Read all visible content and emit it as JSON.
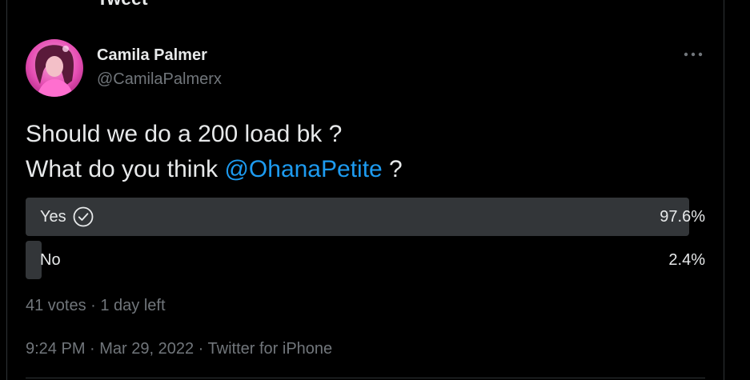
{
  "header": {
    "title": "Tweet"
  },
  "author": {
    "display_name": "Camila Palmer",
    "handle": "@CamilaPalmerx",
    "avatar_icon": "profile-photo"
  },
  "tweet": {
    "line1": "Should we do a 200 load bk ?",
    "line2_prefix": "What do you think ",
    "mention": "@OhanaPetite",
    "line2_suffix": " ?"
  },
  "poll": {
    "options": [
      {
        "label": "Yes",
        "percent_text": "97.6%",
        "share": 0.976,
        "winner": true
      },
      {
        "label": "No",
        "percent_text": "2.4%",
        "share": 0.024,
        "winner": false
      }
    ],
    "meta": "41 votes · 1 day left"
  },
  "footer": {
    "time": "9:24 PM",
    "sep1": " · ",
    "date": "Mar 29, 2022",
    "sep2": " · ",
    "source": "Twitter for iPhone"
  },
  "colors": {
    "background": "#000000",
    "text": "#e7e9ea",
    "muted": "#71767b",
    "accent": "#1d9bf0",
    "poll_winner_bar": "#333639",
    "poll_other_bar": "#333639"
  }
}
